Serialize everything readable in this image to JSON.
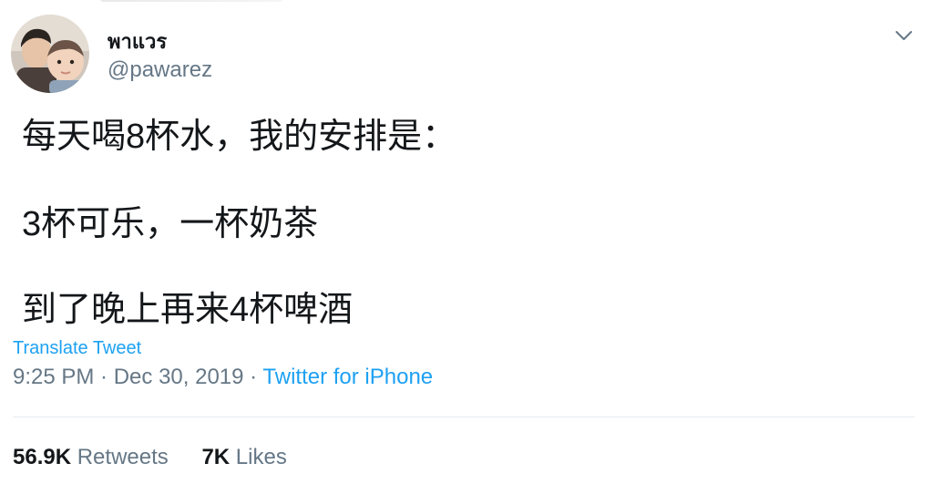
{
  "author": {
    "display_name": "พาแวร",
    "handle": "@pawarez"
  },
  "tweet": {
    "lines": [
      "每天喝8杯水，我的安排是：",
      "3杯可乐，一杯奶茶",
      "到了晚上再来4杯啤酒"
    ],
    "translate_label": "Translate Tweet",
    "time": "9:25 PM",
    "separator": " · ",
    "date": "Dec 30, 2019",
    "source": "Twitter for iPhone"
  },
  "stats": {
    "retweets_count": "56.9K",
    "retweets_label": "Retweets",
    "likes_count": "7K",
    "likes_label": "Likes"
  },
  "colors": {
    "text_primary": "#14171a",
    "text_secondary": "#657786",
    "link_blue": "#1da1f2",
    "divider": "#e6ecf0"
  },
  "icons": {
    "menu": "chevron-down-icon"
  }
}
